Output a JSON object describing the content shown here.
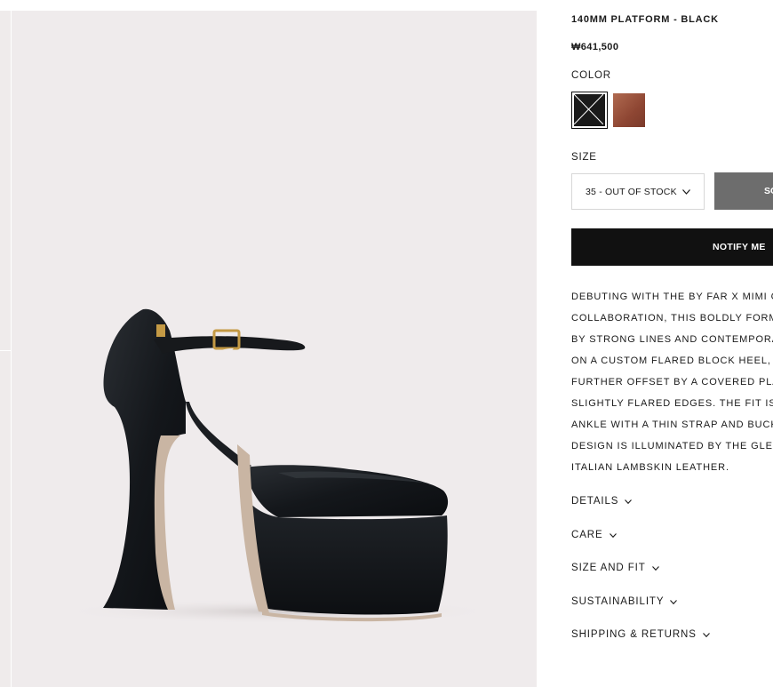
{
  "product": {
    "title": "140MM PLATFORM - BLACK",
    "price": "₩641,500"
  },
  "color": {
    "label": "COLOR",
    "swatches": [
      {
        "name": "black",
        "selected": true,
        "hex": "#1a1a1a"
      },
      {
        "name": "brown",
        "selected": false,
        "hex": "#9a513b"
      }
    ]
  },
  "size": {
    "label": "SIZE",
    "selected": "35 - OUT OF STOCK"
  },
  "buttons": {
    "sold_out": "SOLD OUT",
    "notify": "NOTIFY ME"
  },
  "description": [
    "DEBUTING WITH THE BY FAR X MIMI CUTTRELL",
    "COLLABORATION, THIS BOLDLY FORMED PUMP",
    "BY STRONG LINES AND CONTEMPORARY STYLE, SITS",
    "ON A CUSTOM FLARED BLOCK HEEL, WHICH IS",
    "FURTHER OFFSET BY A COVERED PLATFORM WITH",
    "SLIGHTLY FLARED EDGES. THE FIT IS SECURED AT THE",
    "ANKLE WITH A THIN STRAP AND BUCKLE. THIS",
    "DESIGN IS ILLUMINATED BY THE GLEAM OF SOFT",
    "ITALIAN LAMBSKIN LEATHER."
  ],
  "accordion": [
    {
      "label": "DETAILS"
    },
    {
      "label": "CARE"
    },
    {
      "label": "SIZE AND FIT"
    },
    {
      "label": "SUSTAINABILITY"
    },
    {
      "label": "SHIPPING & RETURNS"
    }
  ],
  "colors": {
    "background": "#efebec",
    "primary_button": "#111111",
    "disabled_button": "#6d6d6d"
  }
}
